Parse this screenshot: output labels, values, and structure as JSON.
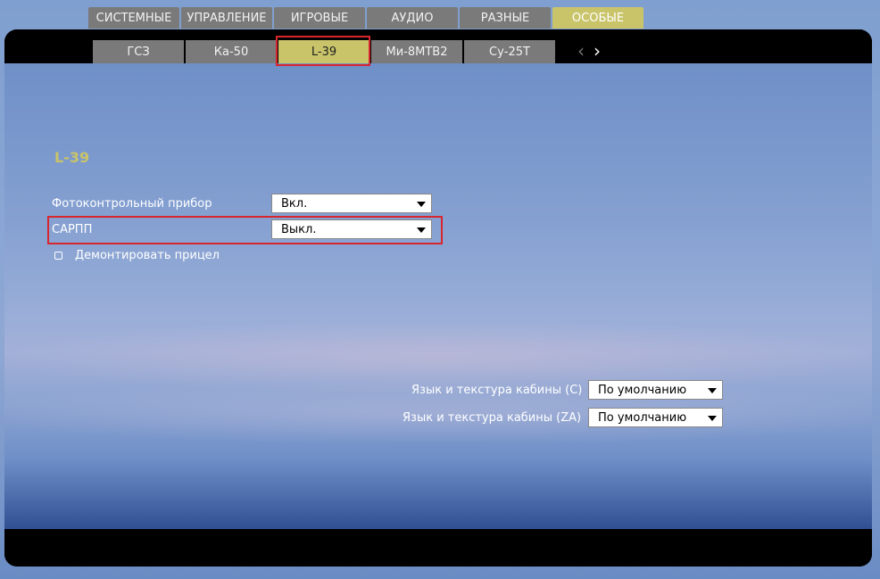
{
  "top_tabs": [
    {
      "label": "СИСТЕМНЫЕ"
    },
    {
      "label": "УПРАВЛЕНИЕ"
    },
    {
      "label": "ИГРОВЫЕ"
    },
    {
      "label": "АУДИО"
    },
    {
      "label": "РАЗНЫЕ"
    },
    {
      "label": "ОСОБЫЕ",
      "active": true
    }
  ],
  "sub_tabs": [
    {
      "label": "ГСЗ"
    },
    {
      "label": "Ка-50"
    },
    {
      "label": "L-39",
      "active": true
    },
    {
      "label": "Ми-8МТВ2"
    },
    {
      "label": "Су-25Т"
    }
  ],
  "nav": {
    "prev_icon": "chevron-left-icon",
    "next_icon": "chevron-right-icon"
  },
  "section": {
    "title": "L-39"
  },
  "settings": {
    "photo_label": "Фотоконтрольный прибор",
    "photo_value": "Вкл.",
    "sarpp_label": "САРПП",
    "sarpp_value": "Выкл.",
    "sight_label": "Демонтировать прицел",
    "sight_checked": false,
    "cockpit_c_label": "Язык и текстура кабины (C)",
    "cockpit_c_value": "По умолчанию",
    "cockpit_za_label": "Язык и текстура кабины (ZA)",
    "cockpit_za_value": "По умолчанию"
  },
  "colors": {
    "accent": "#c9c46a",
    "tab_inactive": "#7a7a7a",
    "highlight": "#d7262e"
  }
}
